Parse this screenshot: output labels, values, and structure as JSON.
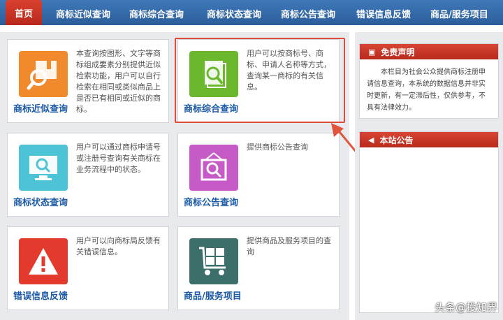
{
  "nav": {
    "home": "首页",
    "items": [
      "商标近似查询",
      "商标综合查询",
      "商标状态查询",
      "商标公告查询",
      "错误信息反馈",
      "商品/服务项目"
    ]
  },
  "cards": [
    {
      "title": "商标近似查询",
      "desc": "本查询按图形、文字等商标组成要素分别提供近似检索功能，用户可以自行检索在相同或类似商品上是否已有相同或近似的商标。",
      "icon": "folder-search-icon",
      "color": "#f08a2c"
    },
    {
      "title": "商标综合查询",
      "desc": "用户可以按商标号、商标、申请人名称等方式，查询某一商标的有关信息。",
      "icon": "document-search-icon",
      "color": "#6bb82e"
    },
    {
      "title": "商标状态查询",
      "desc": "用户可以通过商标申请号或注册号查询有关商标在业务流程中的状态。",
      "icon": "monitor-search-icon",
      "color": "#4cc3d6"
    },
    {
      "title": "商标公告查询",
      "desc": "提供商标公告查询",
      "icon": "frame-search-icon",
      "color": "#c65ac6"
    },
    {
      "title": "错误信息反馈",
      "desc": "用户可以向商标局反馈有关错误信息。",
      "icon": "warning-icon",
      "color": "#e43a2e"
    },
    {
      "title": "商品/服务项目",
      "desc": "提供商品及服务项目的查询",
      "icon": "cart-icon",
      "color": "#3c6e6a"
    }
  ],
  "sidebar": {
    "disclaimer_title": "免责声明",
    "disclaimer_text": "本栏目为社会公众提供商标注册申请信息查询，本系统的数据信息并非实时更新，有一定滞后性，仅供参考，不具有法律效力。",
    "notice_title": "本站公告"
  },
  "watermark": "头条@投知界",
  "colors": {
    "nav": "#2f64a3",
    "accent_red": "#d23c2c",
    "link_blue": "#1d5aa6"
  }
}
